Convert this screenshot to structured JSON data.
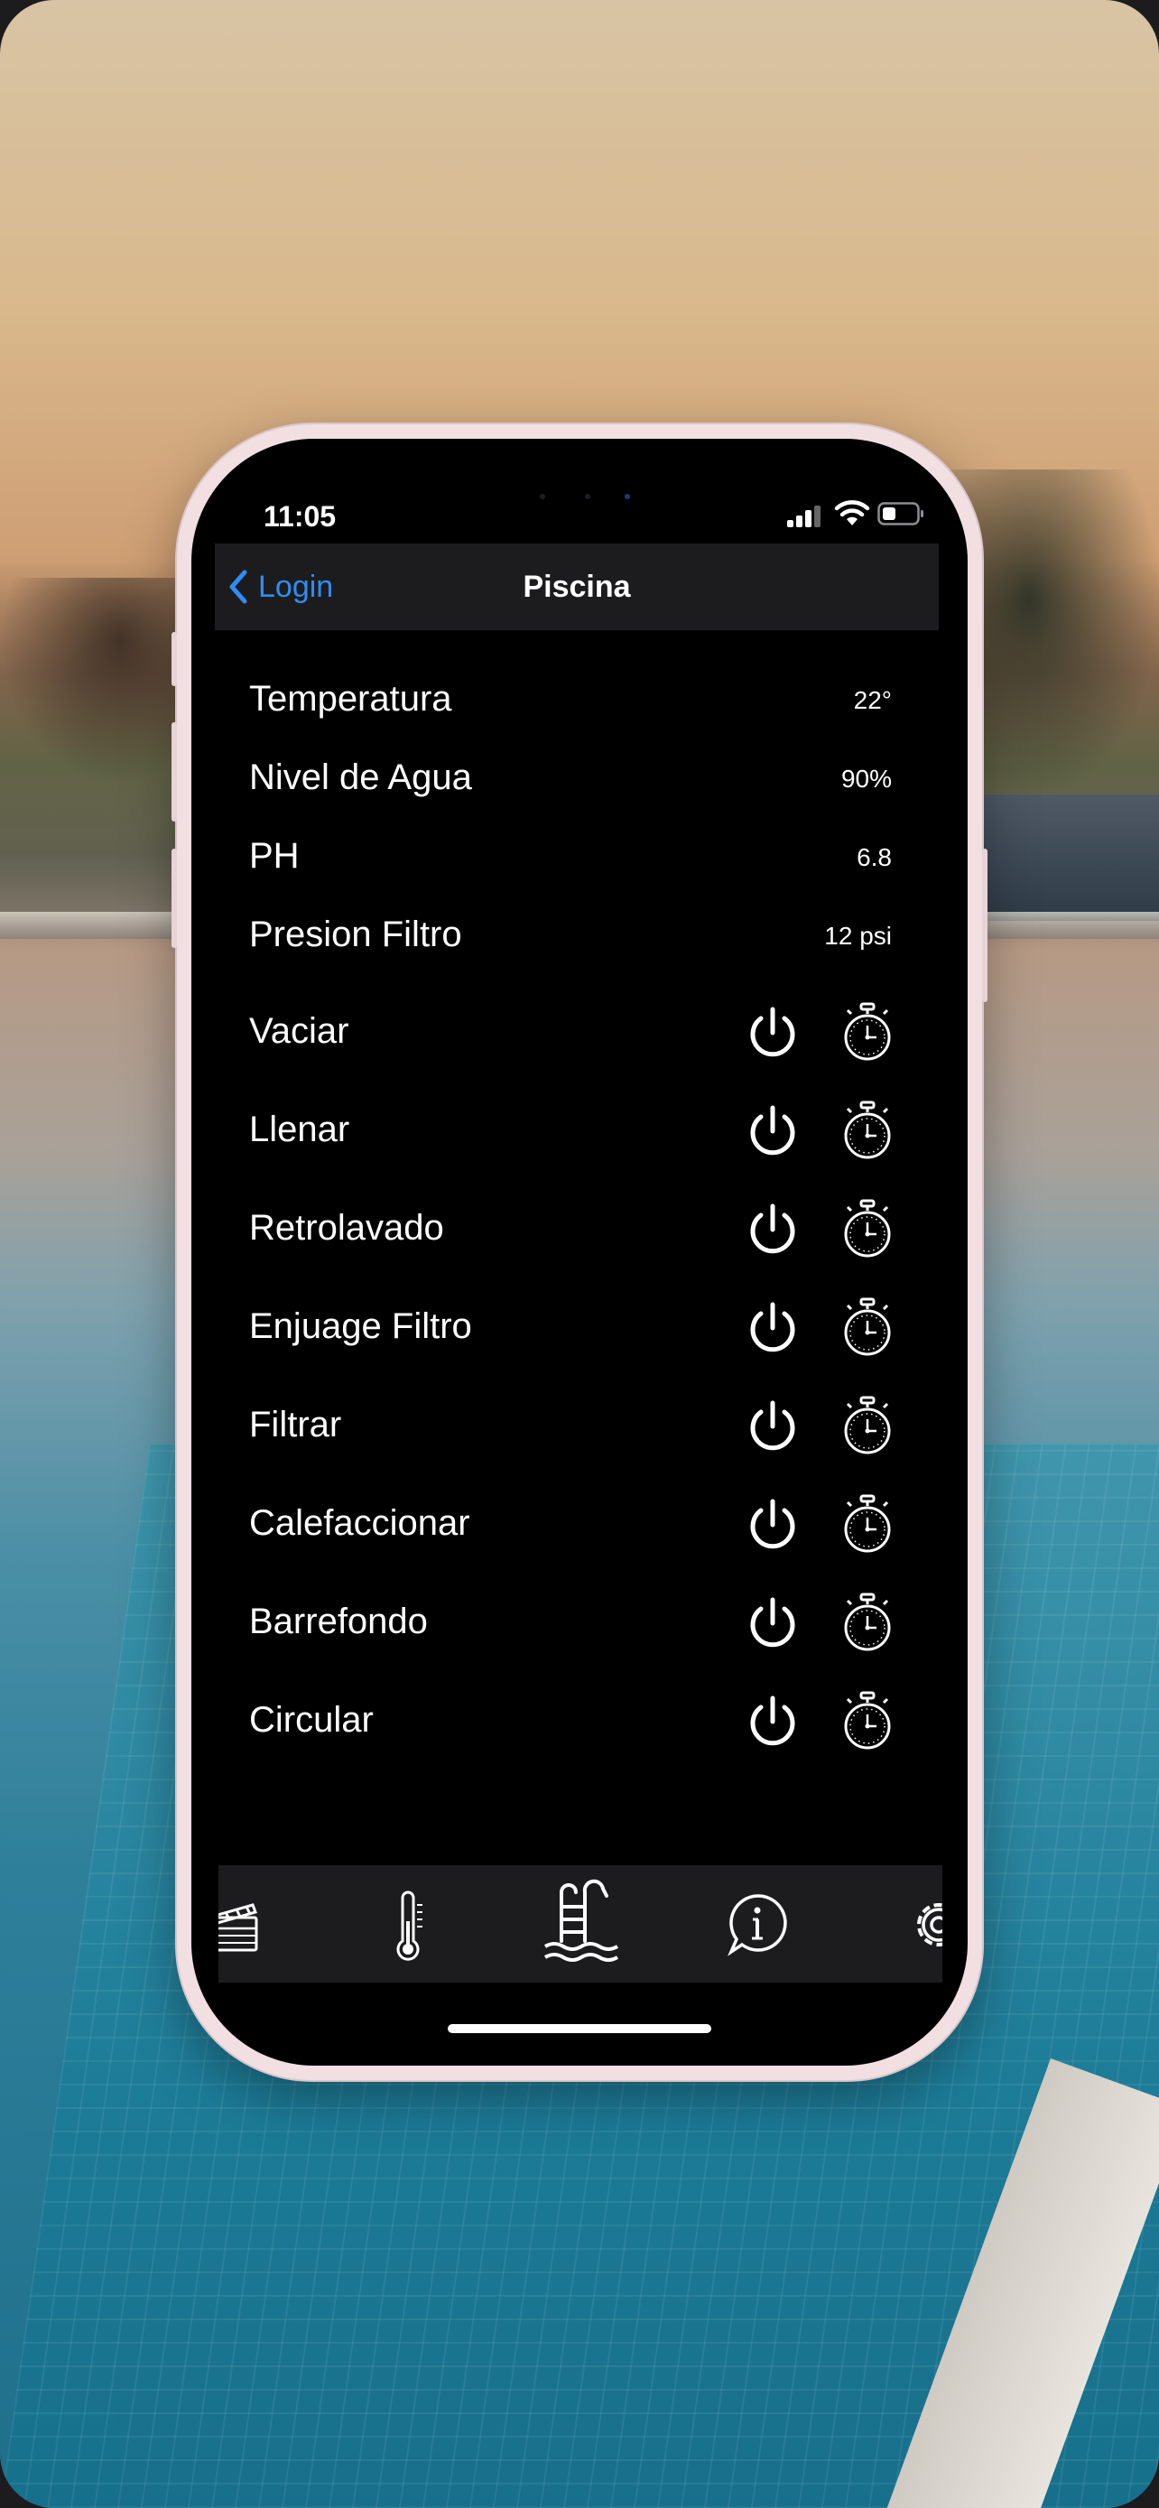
{
  "status_bar": {
    "time": "11:05"
  },
  "nav": {
    "back_label": "Login",
    "title": "Piscina"
  },
  "readings": [
    {
      "label": "Temperatura",
      "value": "22°"
    },
    {
      "label": "Nivel de Agua",
      "value": "90%"
    },
    {
      "label": "PH",
      "value": "6.8"
    },
    {
      "label": "Presion Filtro",
      "value": "12 psi"
    }
  ],
  "actions": [
    {
      "label": "Vaciar"
    },
    {
      "label": "Llenar"
    },
    {
      "label": "Retrolavado"
    },
    {
      "label": "Enjuage Filtro"
    },
    {
      "label": "Filtrar"
    },
    {
      "label": "Calefaccionar"
    },
    {
      "label": "Barrefondo"
    },
    {
      "label": "Circular"
    }
  ],
  "tabs": [
    {
      "icon": "clapperboard-icon"
    },
    {
      "icon": "thermometer-icon"
    },
    {
      "icon": "pool-ladder-icon"
    },
    {
      "icon": "info-bubble-icon"
    },
    {
      "icon": "gear-icon"
    }
  ],
  "colors": {
    "accent": "#2f8cf5",
    "bar_background": "#1c1c1e",
    "screen_background": "#000000"
  }
}
